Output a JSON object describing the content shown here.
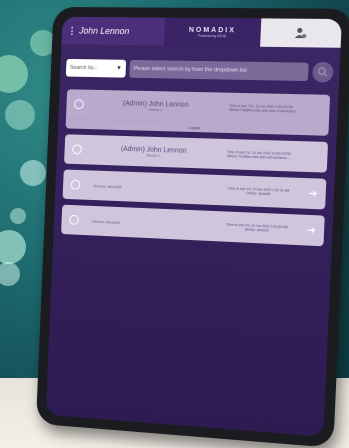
{
  "header": {
    "user_name": "John Lennon",
    "logo_title": "NOMADIX",
    "logo_subtitle": "Powered by ATHE"
  },
  "search": {
    "select_label": "Search by...",
    "input_placeholder": "Please select search by from the dropdown list"
  },
  "sessions": [
    {
      "name": "(Admin) John Lennon",
      "device": "Device 1",
      "time": "Time of use: Thu, 23 Jun 2022 2:30:16 PM",
      "detail": "Where: Facilities web and room Conferences",
      "action": "Logout"
    },
    {
      "name": "(Admin) John Lennon",
      "device": "Device 1",
      "time": "Time of use: Fri, 24 Jun 2022 12:40:19 PM",
      "detail": "Where: Facilities web with web entrance..."
    },
    {
      "name": "Device: deviceB",
      "device": "",
      "time": "Time of use: Fri, 24 Jun 2022 1:02:31 AM",
      "detail": "Device: deviceB"
    },
    {
      "name": "Device: deviceA",
      "device": "",
      "time": "Time of use: Fri, 24 Jun 2022 1:02:33 AM",
      "detail": "Device: deviceA"
    }
  ],
  "colors": {
    "screen_bg": "#34205b",
    "topbar_user": "#4b2f7a",
    "card_bg": "#cfc5dc"
  }
}
